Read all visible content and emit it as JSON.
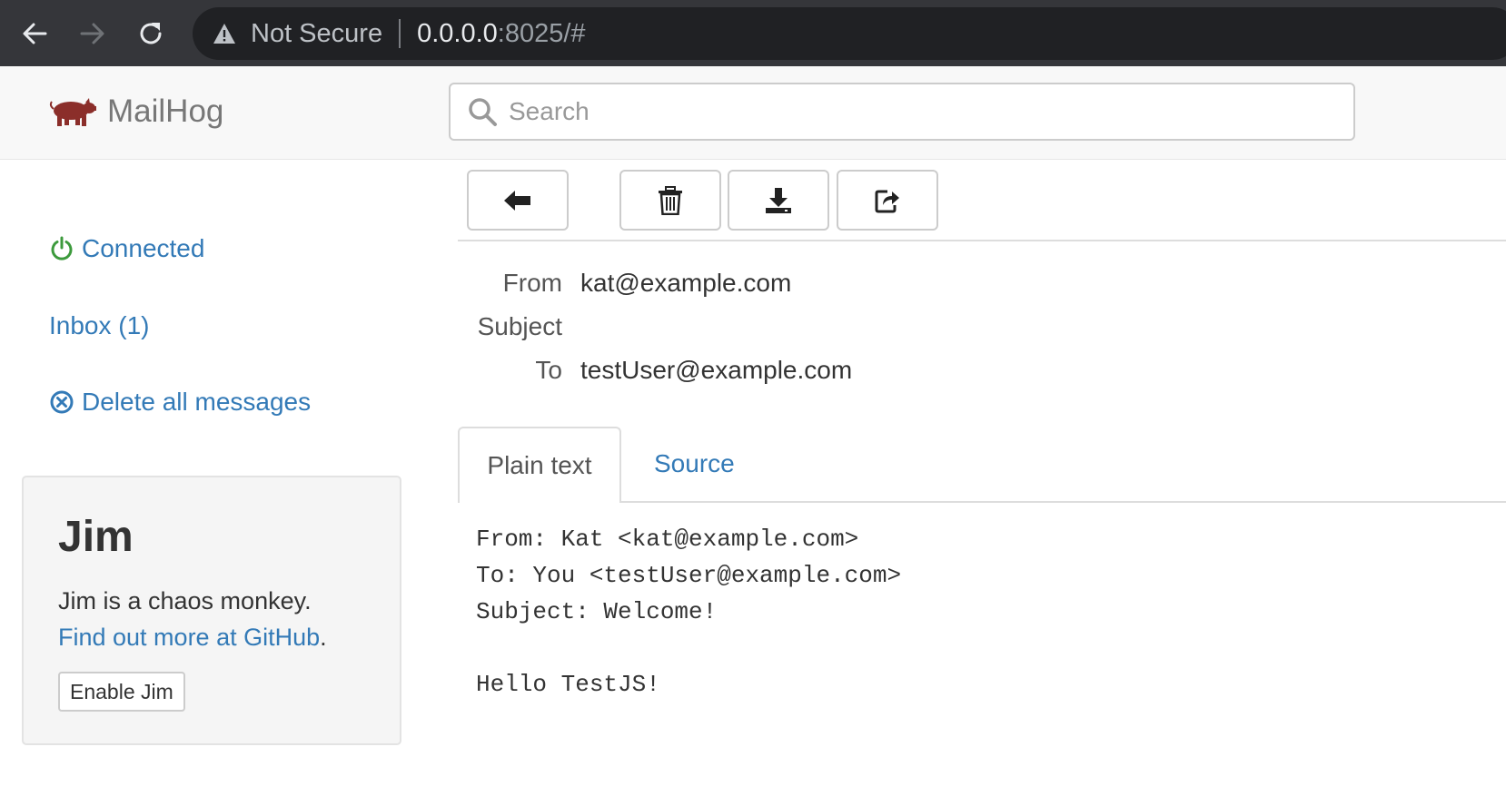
{
  "browser": {
    "security_label": "Not Secure",
    "url_host": "0.0.0.0",
    "url_rest": ":8025/#"
  },
  "header": {
    "brand": "MailHog",
    "search_placeholder": "Search",
    "brand_color": "#8b2e2a"
  },
  "sidebar": {
    "connected": "Connected",
    "inbox": "Inbox (1)",
    "delete_all": "Delete all messages",
    "connected_icon_color": "#3c9a3c",
    "link_color": "#337ab7"
  },
  "jim": {
    "title": "Jim",
    "description": "Jim is a chaos monkey.",
    "link": "Find out more at GitHub",
    "link_suffix": ".",
    "button": "Enable Jim"
  },
  "toolbar": {
    "icons": [
      "arrow-left-icon",
      "trash-icon",
      "download-icon",
      "share-icon"
    ]
  },
  "message": {
    "headers": [
      {
        "label": "From",
        "value": "kat@example.com"
      },
      {
        "label": "Subject",
        "value": ""
      },
      {
        "label": "To",
        "value": "testUser@example.com"
      }
    ],
    "tabs": [
      "Plain text",
      "Source"
    ],
    "body_lines": [
      "From: Kat <kat@example.com>",
      "To: You <testUser@example.com>",
      "Subject: Welcome!",
      "",
      "Hello TestJS!"
    ]
  }
}
